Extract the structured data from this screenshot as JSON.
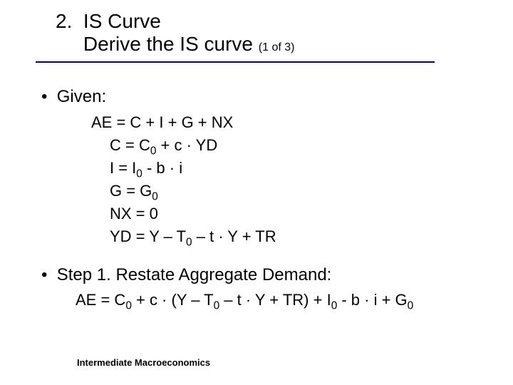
{
  "header": {
    "number": "2.",
    "title1": "IS Curve",
    "title2": "Derive the IS curve",
    "pager": "(1 of 3)"
  },
  "bullets": {
    "given": "Given:",
    "step1": "Step 1. Restate Aggregate Demand:"
  },
  "equations": {
    "ae": "AE = C + I + G + NX",
    "c_pre": "C = C",
    "c_post": " + c · YD",
    "i_pre": "I = I",
    "i_post": " - b · i",
    "g_pre": "G = G",
    "nx": "NX = 0",
    "yd_pre": "YD = Y – T",
    "yd_post": " – t · Y + TR",
    "step1_a": "AE = C",
    "step1_b": " + c · (Y – T",
    "step1_c": " – t · Y + TR) + I",
    "step1_d": " - b · i + G",
    "sub0": "0"
  },
  "footer": "Intermediate Macroeconomics"
}
